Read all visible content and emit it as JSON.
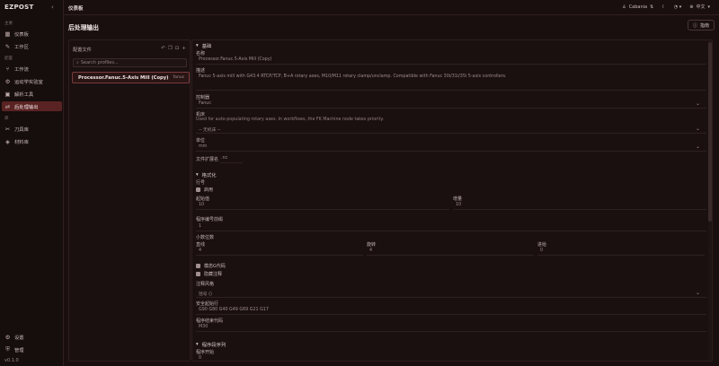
{
  "app": {
    "brand": "EZPOST",
    "version": "v0.1.0"
  },
  "sidebar": {
    "sections": {
      "main": "主要",
      "config": "配置",
      "library": "库"
    },
    "items": [
      {
        "label": "仪表板",
        "icon": "dashboard-icon"
      },
      {
        "label": "工作区",
        "icon": "wrench-icon"
      },
      {
        "label": "工作流",
        "icon": "workflow-icon"
      },
      {
        "label": "运动学实验室",
        "icon": "gear-icon"
      },
      {
        "label": "解析工具",
        "icon": "parser-icon"
      },
      {
        "label": "后处理输出",
        "icon": "output-icon"
      },
      {
        "label": "刀具库",
        "icon": "tool-icon"
      },
      {
        "label": "材料库",
        "icon": "layers-icon"
      }
    ],
    "bottom": [
      {
        "label": "设置"
      },
      {
        "label": "管理"
      }
    ]
  },
  "topbar": {
    "breadcrumb": "仪表板",
    "user": "Cabania",
    "language": "中文"
  },
  "page": {
    "title": "后处理输出",
    "help": "指南"
  },
  "profiles": {
    "title": "配置文件",
    "search_placeholder": "Search profiles...",
    "selected": {
      "name": "Processor.Fanuc.5-Axis Mill (Copy)",
      "controller": "fanuc"
    }
  },
  "editor": {
    "basic": {
      "header": "基础",
      "name_label": "名称",
      "name_value": "Processor.Fanuc.5-Axis Mill (Copy)",
      "desc_label": "描述",
      "desc_value": "Fanuc 5-axis mill with G43.4 RTCP/TCP, B+A rotary axes, M10/M11 rotary clamp/unclamp. Compatible with Fanuc 30i/31i/35i 5-axis controllers.",
      "controller_label": "控制器",
      "controller_value": "Fanuc",
      "machine_label": "机床",
      "machine_hint": "Used for auto-populating rotary axes. In workflows, the FK Machine node takes priority.",
      "machine_value": "-- 无机床 --",
      "unit_label": "单位",
      "unit_value": "mm",
      "ext_label": "文件扩展名",
      "ext_value": ".nc"
    },
    "format": {
      "header": "格式化",
      "line_num_label": "行号",
      "enable_label": "启用",
      "start_label": "起始值",
      "start_value": "10",
      "inc_label": "增量",
      "inc_value": "10",
      "prog_num_label": "程序编号前缀",
      "prog_num_value": "1",
      "decimals_label": "小数位数",
      "linear_label": "直线",
      "linear_value": "4",
      "rotary_label": "旋转",
      "rotary_value": "4",
      "feed_label": "进给",
      "feed_value": "0",
      "modal_label": "模态G代码",
      "hide_comment_label": "隐藏注释",
      "comment_style_label": "注释风格",
      "comment_style_value": "括号 ()",
      "safe_start_label": "安全起始行",
      "safe_start_value": "G90 G80 G40 G49 G69 G21 G17",
      "prog_end_label": "程序结束代码",
      "prog_end_value": "M30"
    },
    "sequence": {
      "header": "程序段序列",
      "start_label": "程序开始",
      "start_value": "0"
    }
  }
}
